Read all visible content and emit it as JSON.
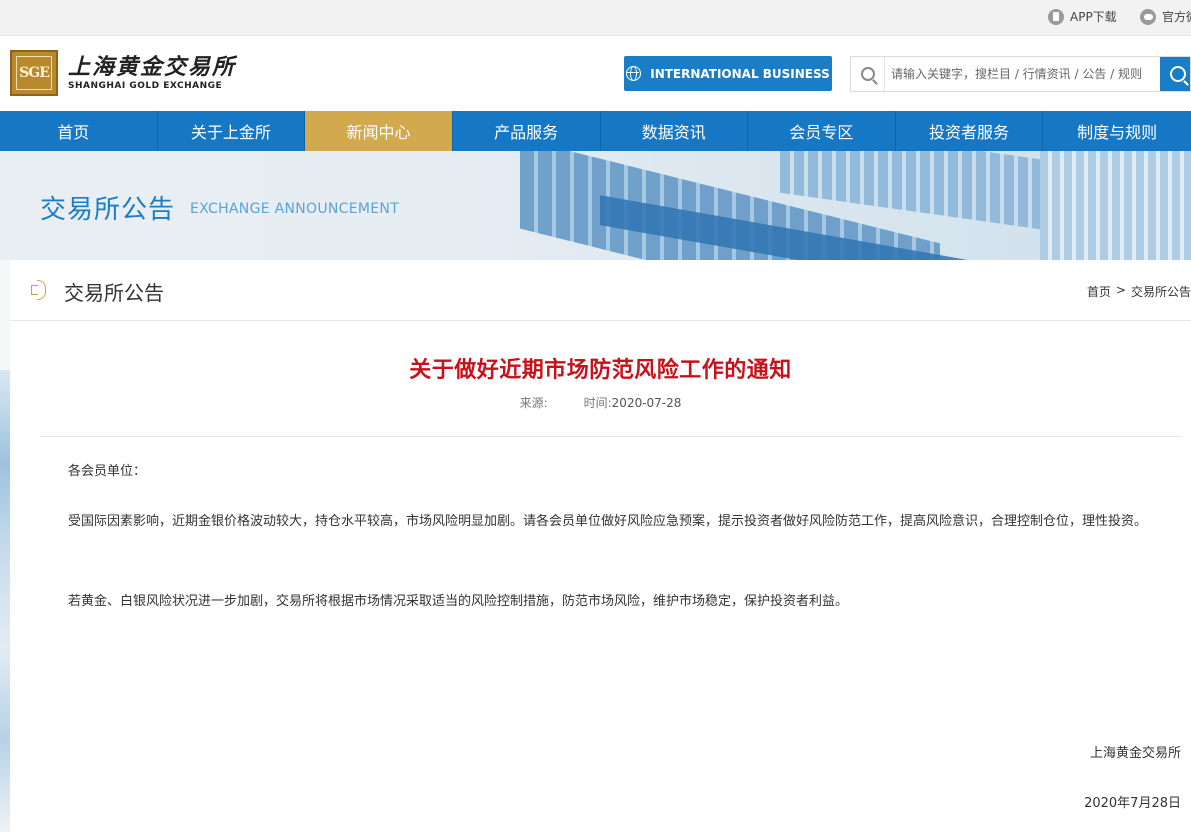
{
  "topbar": {
    "app_label": "APP下载",
    "wechat_label": "官方微"
  },
  "header": {
    "logo_mark": "SGE",
    "logo_cn": "上海黄金交易所",
    "logo_en": "SHANGHAI GOLD EXCHANGE",
    "intl_button": "INTERNATIONAL BUSINESS",
    "search_placeholder": "请输入关键字，搜栏目 / 行情资讯 / 公告 / 规则"
  },
  "nav": {
    "items": [
      {
        "label": "首页"
      },
      {
        "label": "关于上金所"
      },
      {
        "label": "新闻中心",
        "active": true
      },
      {
        "label": "产品服务"
      },
      {
        "label": "数据资讯"
      },
      {
        "label": "会员专区"
      },
      {
        "label": "投资者服务"
      },
      {
        "label": "制度与规则"
      }
    ]
  },
  "banner": {
    "title": "交易所公告",
    "subtitle": "EXCHANGE ANNOUNCEMENT"
  },
  "panel": {
    "title": "交易所公告",
    "breadcrumb": [
      "首页",
      ">",
      "交易所公告"
    ]
  },
  "article": {
    "title": "关于做好近期市场防范风险工作的通知",
    "source_label": "来源:",
    "time_label": "时间:",
    "date": "2020-07-28",
    "salutation": "各会员单位：",
    "paragraph1": "受国际因素影响，近期金银价格波动较大，持仓水平较高，市场风险明显加剧。请各会员单位做好风险应急预案，提示投资者做好风险防范工作，提高风险意识，合理控制仓位，理性投资。",
    "paragraph2": "若黄金、白银风险状况进一步加剧，交易所将根据市场情况采取适当的风险控制措施，防范市场风险，维护市场稳定，保护投资者利益。",
    "signature": "上海黄金交易所",
    "sign_date": "2020年7月28日"
  },
  "colors": {
    "primary_blue": "#1677c4",
    "gold_active": "#d2a94c",
    "title_red": "#c8121b"
  }
}
